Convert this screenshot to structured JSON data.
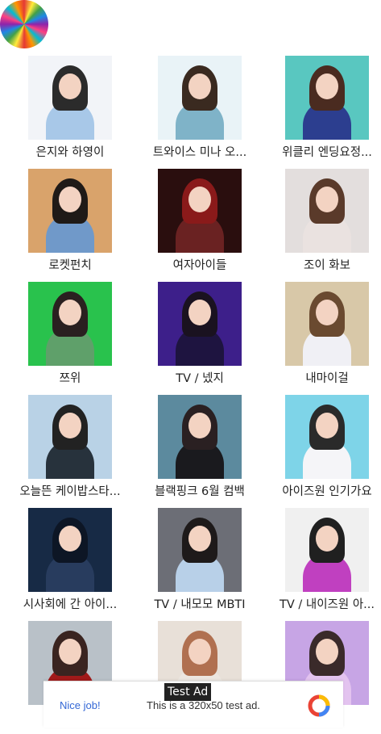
{
  "app": {
    "logo_icon": "rainbow-burst-icon"
  },
  "items": [
    {
      "caption": "은지와 하영이",
      "bg": "#f2f4f8",
      "fig": "#a8c8e8",
      "hair": "#2b2b2b"
    },
    {
      "caption": "트와이스 미나 오...",
      "bg": "#e9f3f7",
      "fig": "#7fb3c8",
      "hair": "#3a2a20"
    },
    {
      "caption": "위클리 엔딩요정...",
      "bg": "#59c7c0",
      "fig": "#2c3e8f",
      "hair": "#4a2b20"
    },
    {
      "caption": "로켓펀치",
      "bg": "#d9a36b",
      "fig": "#7099c9",
      "hair": "#1f1a17"
    },
    {
      "caption": "여자아이들",
      "bg": "#2a0e0e",
      "fig": "#6a2222",
      "hair": "#8a1a1a"
    },
    {
      "caption": "조이 화보",
      "bg": "#e3dedd",
      "fig": "#eae2e0",
      "hair": "#5a3a2a"
    },
    {
      "caption": "쯔위",
      "bg": "#29c24d",
      "fig": "#5fa06a",
      "hair": "#2a2020"
    },
    {
      "caption": "TV / 넸지",
      "bg": "#3d1f8a",
      "fig": "#1e1440",
      "hair": "#1a1220"
    },
    {
      "caption": "내마이걸",
      "bg": "#d8c8a8",
      "fig": "#f0f0f5",
      "hair": "#6a4a30"
    },
    {
      "caption": "오늘뜬 케이밥스타...",
      "bg": "#b9d2e6",
      "fig": "#27323c",
      "hair": "#222"
    },
    {
      "caption": "블랙핑크 6월 컴백",
      "bg": "#5c8a9e",
      "fig": "#1a1a1e",
      "hair": "#2a2022"
    },
    {
      "caption": "아이즈원 인기가요",
      "bg": "#7ed4e8",
      "fig": "#f5f5f8",
      "hair": "#2a2a2a"
    },
    {
      "caption": "시사회에 간 아이...",
      "bg": "#172a45",
      "fig": "#283c5e",
      "hair": "#0d1625"
    },
    {
      "caption": "TV / 내모모 MBTI",
      "bg": "#6c6e76",
      "fig": "#b8d0e8",
      "hair": "#1e1a1a"
    },
    {
      "caption": "TV / 내이즈원 아...",
      "bg": "#f0f0f0",
      "fig": "#c040c0",
      "hair": "#202020"
    },
    {
      "caption": "",
      "bg": "#b9c1c8",
      "fig": "#a01a1a",
      "hair": "#3a2420"
    },
    {
      "caption": "",
      "bg": "#e8e0d8",
      "fig": "#ece6e0",
      "hair": "#b07050"
    },
    {
      "caption": "",
      "bg": "#c7a5e5",
      "fig": "#e3c3ef",
      "hair": "#3a2a2a"
    }
  ],
  "ad": {
    "label": "Test Ad",
    "left_text": "Nice job!",
    "main_text": "This is a 320x50 test ad.",
    "icon": "adchoices-logo-icon"
  }
}
